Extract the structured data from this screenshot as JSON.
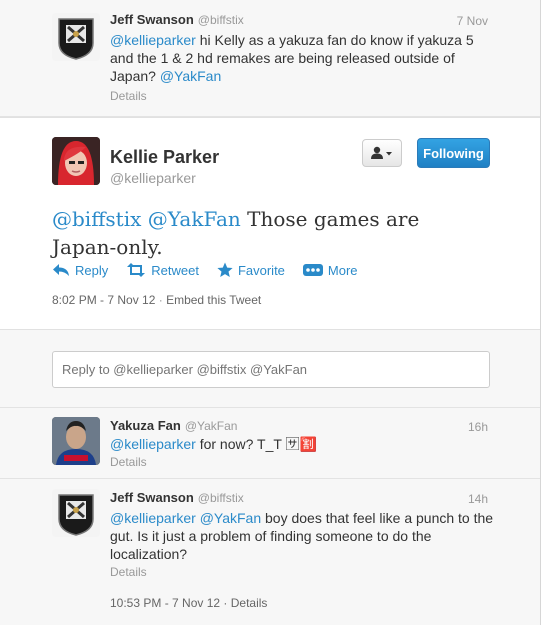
{
  "colors": {
    "link": "#2a8ac9",
    "follow_button": "#2b95d7"
  },
  "tweet1": {
    "name": "Jeff Swanson",
    "handle": "@biffstix",
    "time": "7 Nov",
    "mention": "@kellieparker",
    "text_before_tag": " hi Kelly as a yakuza fan do know if yakuza 5 and the 1 & 2 hd remakes are being released outside of Japan? ",
    "tag": "@YakFan",
    "details": "Details"
  },
  "main": {
    "name": "Kellie Parker",
    "handle": "@kellieparker",
    "user_dropdown_icon": "user-dropdown-icon",
    "follow_label": "Following",
    "mention1": "@biffstix",
    "mention2": "@YakFan",
    "text": " Those games are Japan-only.",
    "actions": {
      "reply": "Reply",
      "retweet": "Retweet",
      "favorite": "Favorite",
      "more": "More"
    },
    "timestamp": "8:02 PM - 7 Nov 12",
    "separator": "·",
    "embed": "Embed this Tweet"
  },
  "reply_box": {
    "placeholder": "Reply to @kellieparker @biffstix @YakFan"
  },
  "tweet2": {
    "name": "Yakuza Fan",
    "handle": "@YakFan",
    "time": "16h",
    "mention": "@kellieparker",
    "text": " for now? T_T 🈂🈹",
    "details": "Details"
  },
  "tweet3": {
    "name": "Jeff Swanson",
    "handle": "@biffstix",
    "time": "14h",
    "mention1": "@kellieparker",
    "mention2": "@YakFan",
    "text": " boy does that feel like a punch to the gut. Is it just a problem of finding someone to do the localization?",
    "details": "Details",
    "timestamp": "10:53 PM - 7 Nov 12",
    "separator": "·",
    "details_link": "Details"
  }
}
